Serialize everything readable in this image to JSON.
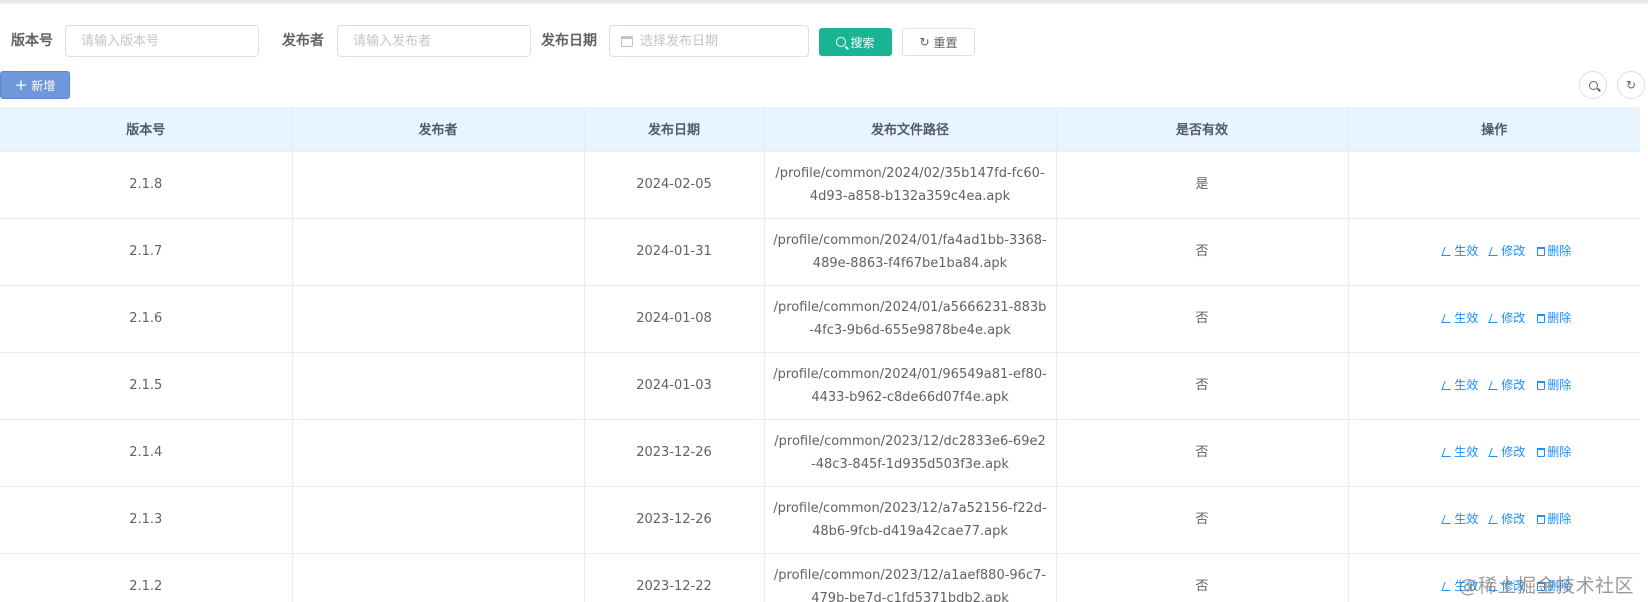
{
  "search": {
    "version_label": "版本号",
    "version_placeholder": "请输入版本号",
    "publisher_label": "发布者",
    "publisher_placeholder": "请输入发布者",
    "date_label": "发布日期",
    "date_placeholder": "选择发布日期",
    "search_label": "搜索",
    "reset_label": "重置"
  },
  "toolbar": {
    "add_label": "新增"
  },
  "table": {
    "headers": [
      "版本号",
      "发布者",
      "发布日期",
      "发布文件路径",
      "是否有效",
      "操作"
    ],
    "rows": [
      {
        "version": "2.1.8",
        "publisher": "",
        "date": "2024-02-05",
        "path": "/profile/common/2024/02/35b147fd-fc60-4d93-a858-b132a359c4ea.apk",
        "valid": "是",
        "ops": []
      },
      {
        "version": "2.1.7",
        "publisher": "",
        "date": "2024-01-31",
        "path": "/profile/common/2024/01/fa4ad1bb-3368-489e-8863-f4f67be1ba84.apk",
        "valid": "否",
        "ops": [
          "生效",
          "修改",
          "删除"
        ]
      },
      {
        "version": "2.1.6",
        "publisher": "",
        "date": "2024-01-08",
        "path": "/profile/common/2024/01/a5666231-883b-4fc3-9b6d-655e9878be4e.apk",
        "valid": "否",
        "ops": [
          "生效",
          "修改",
          "删除"
        ]
      },
      {
        "version": "2.1.5",
        "publisher": "",
        "date": "2024-01-03",
        "path": "/profile/common/2024/01/96549a81-ef80-4433-b962-c8de66d07f4e.apk",
        "valid": "否",
        "ops": [
          "生效",
          "修改",
          "删除"
        ]
      },
      {
        "version": "2.1.4",
        "publisher": "",
        "date": "2023-12-26",
        "path": "/profile/common/2023/12/dc2833e6-69e2-48c3-845f-1d935d503f3e.apk",
        "valid": "否",
        "ops": [
          "生效",
          "修改",
          "删除"
        ]
      },
      {
        "version": "2.1.3",
        "publisher": "",
        "date": "2023-12-26",
        "path": "/profile/common/2023/12/a7a52156-f22d-48b6-9fcb-d419a42cae77.apk",
        "valid": "否",
        "ops": [
          "生效",
          "修改",
          "删除"
        ]
      },
      {
        "version": "2.1.2",
        "publisher": "",
        "date": "2023-12-22",
        "path": "/profile/common/2023/12/a1aef880-96c7-479b-be7d-c1fd5371bdb2.apk",
        "valid": "否",
        "ops": [
          "生效",
          "修改",
          "删除"
        ]
      }
    ]
  },
  "watermark": "@稀土掘金技术社区",
  "colors": {
    "primary": "#1ab394",
    "add_button": "#6e98d9",
    "link": "#1890ff",
    "header_bg": "#e8f4fe"
  }
}
